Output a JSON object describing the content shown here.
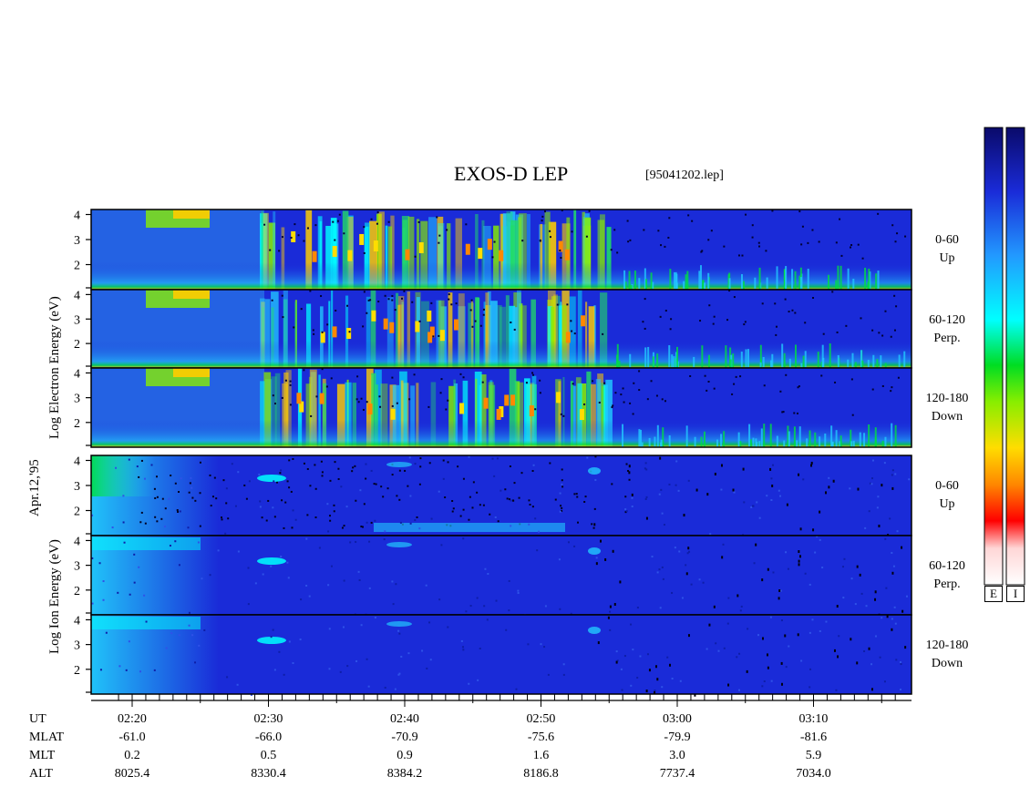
{
  "title": "EXOS-D LEP",
  "file": "[95041202.lep]",
  "date_label": "Apr.12,'95",
  "colors": {
    "background_low": "#1a2bd8",
    "frame": "#000000"
  },
  "chart_data": [
    {
      "type": "heatmap",
      "group": "Electron",
      "ylabel": "Log Electron Energy (eV)",
      "ylim": [
        1,
        4.2
      ],
      "yticks": [
        "2",
        "3",
        "4"
      ],
      "panels": [
        {
          "pitch": "0-60",
          "dir": "Up"
        },
        {
          "pitch": "60-120",
          "dir": "Perp."
        },
        {
          "pitch": "120-180",
          "dir": "Down"
        }
      ]
    },
    {
      "type": "heatmap",
      "group": "Ion",
      "ylabel": "Log Ion Energy (eV)",
      "ylim": [
        1,
        4.2
      ],
      "yticks": [
        "2",
        "3",
        "4"
      ],
      "panels": [
        {
          "pitch": "0-60",
          "dir": "Up"
        },
        {
          "pitch": "60-120",
          "dir": "Perp."
        },
        {
          "pitch": "120-180",
          "dir": "Down"
        }
      ]
    }
  ],
  "axis": {
    "labels": [
      "UT",
      "MLAT",
      "MLT",
      "ALT"
    ],
    "ticks": [
      {
        "UT": "02:20",
        "MLAT": "-61.0",
        "MLT": "0.2",
        "ALT": "8025.4"
      },
      {
        "UT": "02:30",
        "MLAT": "-66.0",
        "MLT": "0.5",
        "ALT": "8330.4"
      },
      {
        "UT": "02:40",
        "MLAT": "-70.9",
        "MLT": "0.9",
        "ALT": "8384.2"
      },
      {
        "UT": "02:50",
        "MLAT": "-75.6",
        "MLT": "1.6",
        "ALT": "8186.8"
      },
      {
        "UT": "03:00",
        "MLAT": "-79.9",
        "MLT": "3.0",
        "ALT": "7737.4"
      },
      {
        "UT": "03:10",
        "MLAT": "-81.6",
        "MLT": "5.9",
        "ALT": "7034.0"
      }
    ]
  },
  "colorbars": [
    {
      "label": "E"
    },
    {
      "label": "I"
    }
  ]
}
